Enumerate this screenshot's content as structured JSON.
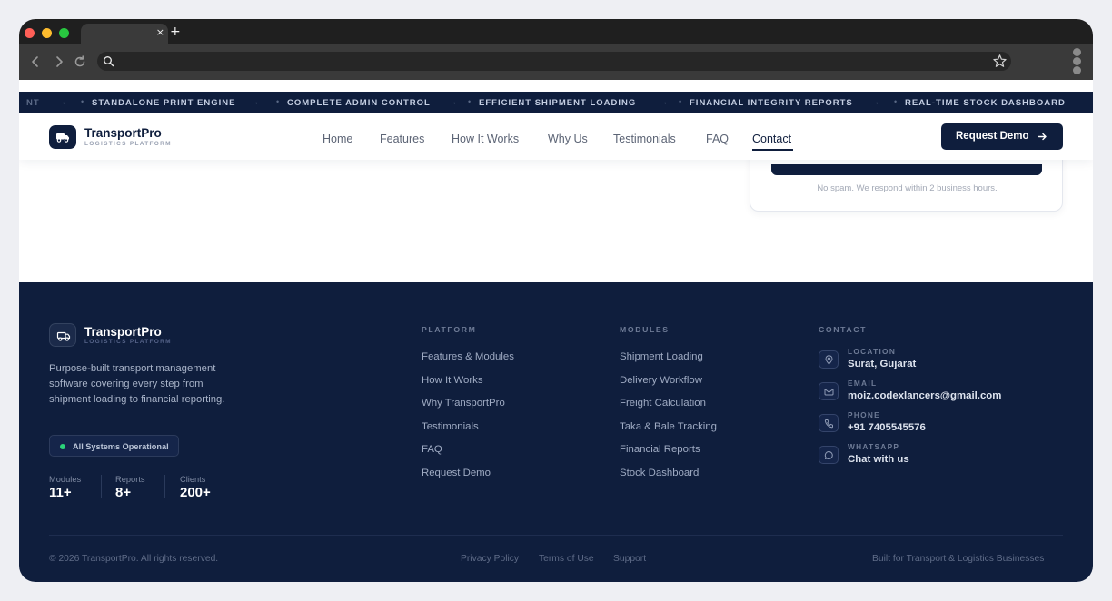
{
  "browser": {
    "tab_close_glyph": "×",
    "new_tab_glyph": "+",
    "icons": [
      "back-icon",
      "forward-icon",
      "reload-icon",
      "search-icon",
      "star-icon",
      "menu-icon"
    ]
  },
  "ticker": {
    "leading_fragment": "NT",
    "items": [
      "STANDALONE PRINT ENGINE",
      "COMPLETE ADMIN CONTROL",
      "EFFICIENT SHIPMENT LOADING",
      "FINANCIAL INTEGRITY REPORTS",
      "REAL-TIME STOCK DASHBOARD"
    ],
    "separator": "•",
    "arrow": "→"
  },
  "brand": {
    "name": "TransportPro",
    "tagline": "LOGISTICS PLATFORM"
  },
  "nav": {
    "links": [
      "Home",
      "Features",
      "How It Works",
      "Why Us",
      "Testimonials",
      "FAQ",
      "Contact"
    ],
    "active": "Contact",
    "cta_label": "Request Demo"
  },
  "form": {
    "note": "No spam. We respond within 2 business hours."
  },
  "footer": {
    "description": "Purpose-built transport management software covering every step from shipment loading to financial reporting.",
    "status": "All Systems Operational",
    "stats": [
      {
        "label": "Modules",
        "value": "11+"
      },
      {
        "label": "Reports",
        "value": "8+"
      },
      {
        "label": "Clients",
        "value": "200+"
      }
    ],
    "platform": {
      "title": "PLATFORM",
      "links": [
        "Features & Modules",
        "How It Works",
        "Why TransportPro",
        "Testimonials",
        "FAQ",
        "Request Demo"
      ]
    },
    "modules": {
      "title": "MODULES",
      "links": [
        "Shipment Loading",
        "Delivery Workflow",
        "Freight Calculation",
        "Taka & Bale Tracking",
        "Financial Reports",
        "Stock Dashboard"
      ]
    },
    "contact": {
      "title": "CONTACT",
      "items": [
        {
          "label": "LOCATION",
          "value": "Surat, Gujarat",
          "icon": "location-pin-icon"
        },
        {
          "label": "EMAIL",
          "value": "moiz.codexlancers@gmail.com",
          "icon": "mail-icon"
        },
        {
          "label": "PHONE",
          "value": "+91 7405545576",
          "icon": "phone-icon"
        },
        {
          "label": "WHATSAPP",
          "value": "Chat with us",
          "icon": "chat-icon"
        }
      ]
    },
    "copyright": "© 2026 TransportPro. All rights reserved.",
    "legal_links": [
      "Privacy Policy",
      "Terms of Use",
      "Support"
    ],
    "built_for": "Built for Transport & Logistics Businesses"
  },
  "colors": {
    "navy": "#0f1e3d",
    "status_green": "#2bd47a",
    "page_bg": "#ffffff"
  }
}
